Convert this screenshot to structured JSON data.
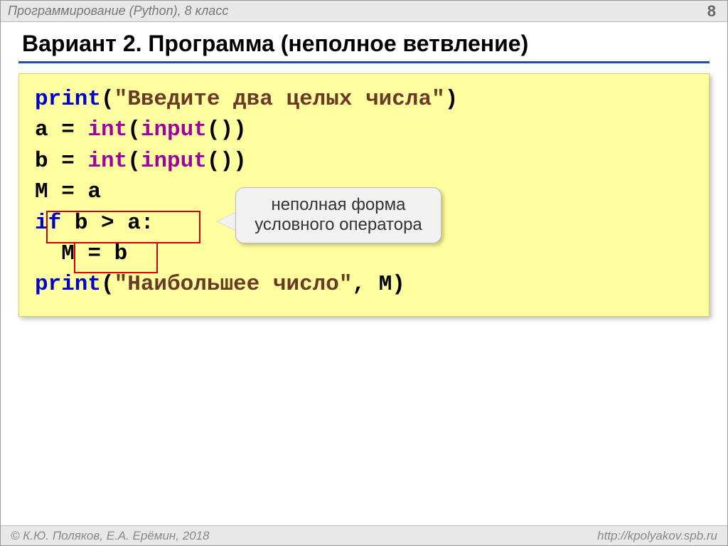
{
  "header": {
    "left": "Программирование (Python), 8 класс",
    "page": "8"
  },
  "title": "Вариант 2. Программа (неполное ветвление)",
  "code": {
    "line1": {
      "print": "print",
      "argL": "(",
      "str": "\"Введите два целых числа\"",
      "argR": ")"
    },
    "line2": {
      "a": "a = ",
      "int": "int",
      "p1": "(",
      "input": "input",
      "p2": "())"
    },
    "line3": {
      "b": "b = ",
      "int": "int",
      "p1": "(",
      "input": "input",
      "p2": "())"
    },
    "line4": "M = a",
    "line5": {
      "ifkw": "if",
      "cond": " b > a:"
    },
    "line6": "  M = b",
    "line7": {
      "print": "print",
      "argL": "(",
      "str": "\"Наибольшее число\"",
      "rest": ", M)"
    }
  },
  "callout": "неполная форма условного оператора",
  "footer": {
    "left": "© К.Ю. Поляков, Е.А. Ерёмин, 2018",
    "right": "http://kpolyakov.spb.ru"
  }
}
